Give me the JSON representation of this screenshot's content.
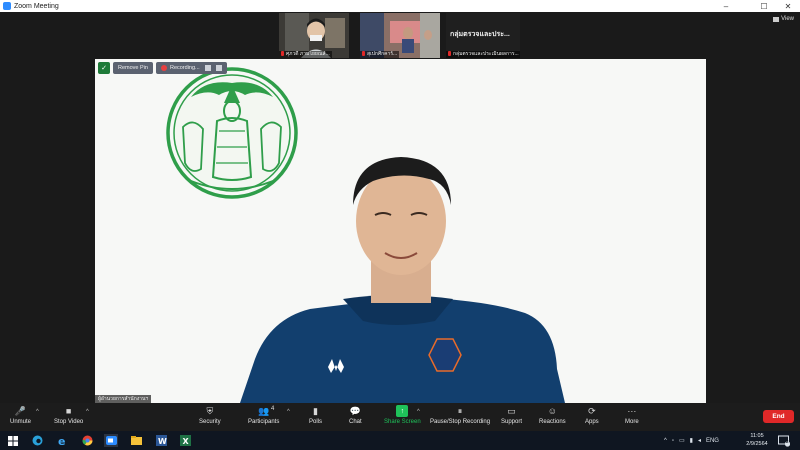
{
  "window": {
    "title": "Zoom Meeting"
  },
  "view_label": "View",
  "thumbnails": [
    {
      "name": "ศุภวดี ภามโยยณส์..."
    },
    {
      "name": "สุเปกศีกคาร์..."
    },
    {
      "title": "กลุ่มตรวจและประ...",
      "name": "กลุ่มตรวจและประเมินผลการ..."
    }
  ],
  "main_video": {
    "remove_label": "Remove Pin",
    "recording_label": "Recording...",
    "speaker_name": "ผู้อำนวยการสำนักงานฯ"
  },
  "toolbar": {
    "unmute": "Unmute",
    "stop_video": "Stop Video",
    "security": "Security",
    "participants": "Participants",
    "participants_count": "4",
    "polls": "Polls",
    "chat": "Chat",
    "share_screen": "Share Screen",
    "pause_stop": "Pause/Stop Recording",
    "support": "Support",
    "reactions": "Reactions",
    "apps": "Apps",
    "more": "More",
    "end": "End"
  },
  "taskbar": {
    "lang": "ENG",
    "time": "11:05",
    "date": "2/9/2564",
    "notif_count": "2"
  },
  "colors": {
    "zoom_blue": "#2d8cff",
    "end_red": "#e02828",
    "share_green": "#1fc25a",
    "emblem_green": "#2f9e4a",
    "shirt_navy": "#123f6e"
  }
}
